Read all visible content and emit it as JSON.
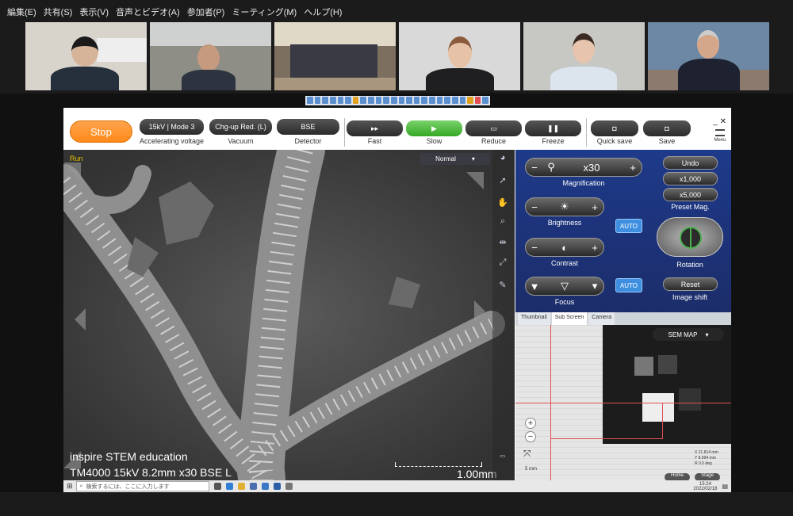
{
  "menu": [
    "編集(E)",
    "共有(S)",
    "表示(V)",
    "音声とビデオ(A)",
    "参加者(P)",
    "ミーティング(M)",
    "ヘルプ(H)"
  ],
  "participants_count": 6,
  "toolbar": {
    "stop": "Stop",
    "accel_value": "15kV | Mode 3",
    "accel_label": "Accelerating voltage",
    "vacuum_value": "Chg-up Red. (L)",
    "vacuum_label": "Vacuum",
    "detector_value": "BSE",
    "detector_label": "Detector",
    "scan_buttons": [
      {
        "glyph": "▸▸",
        "label": "Fast"
      },
      {
        "glyph": "▶",
        "label": "Slow"
      },
      {
        "glyph": "▭",
        "label": "Reduce"
      },
      {
        "glyph": "❚❚",
        "label": "Freeze"
      }
    ],
    "quick_save": "Quick save",
    "save": "Save",
    "menu_label": "Menu"
  },
  "view": {
    "status": "Run",
    "mode": "Normal",
    "caption1": "inspire STEM education",
    "caption2": "TM4000 15kV 8.2mm x30 BSE L",
    "scale": "1.00mm"
  },
  "panel": {
    "magnification_value": "x30",
    "magnification_label": "Magnification",
    "undo": "Undo",
    "preset1": "x1,000",
    "preset2": "x5,000",
    "preset_label": "Preset Mag.",
    "brightness_label": "Brightness",
    "contrast_label": "Contrast",
    "auto": "AUTO",
    "rotation_label": "Rotation",
    "focus_label": "Focus",
    "reset": "Reset",
    "image_shift_label": "Image shift"
  },
  "tabs": [
    "Thumbnail",
    "Sub Screen",
    "Camera"
  ],
  "sub": {
    "map_label": "SEM MAP",
    "scale": "5 mm",
    "coords": "X 21.814 mm\nY 8.994 mm\nR 0.0 deg",
    "home": "Home",
    "stage": "Stage"
  },
  "taskbar": {
    "search_placeholder": "検索するには、ここに入力します",
    "time": "15:24",
    "date": "2022/02/18"
  },
  "colors": {
    "stop": "#ff8a1a",
    "accent_green": "#35a826",
    "panel_blue": "#1e3a8a",
    "auto_blue": "#3f8fe0"
  }
}
